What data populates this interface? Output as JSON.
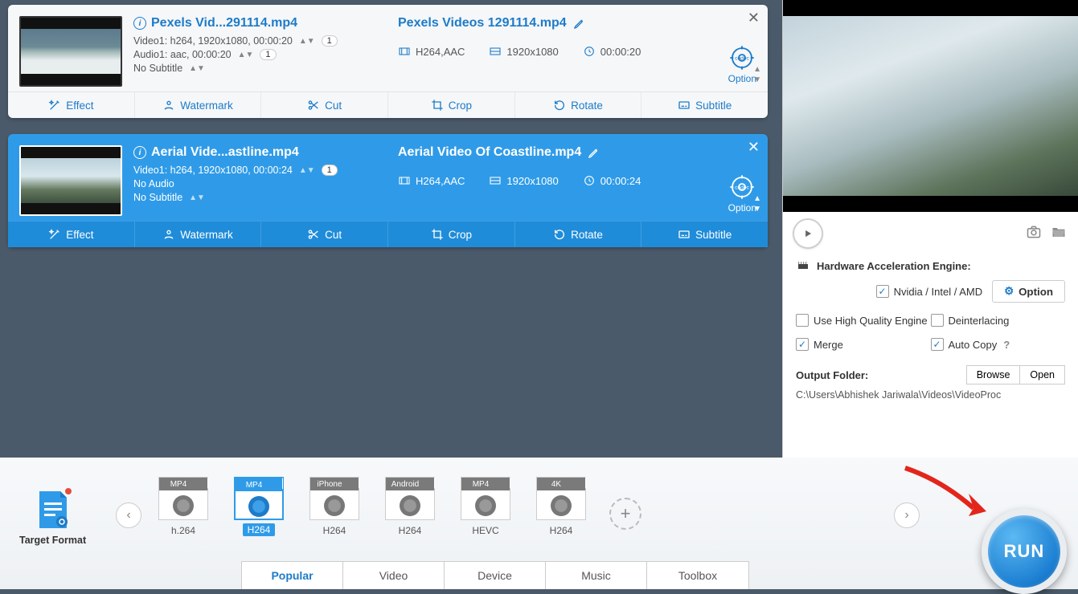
{
  "queue": [
    {
      "title_short": "Pexels Vid...291114.mp4",
      "video_line": "Video1: h264, 1920x1080, 00:00:20",
      "video_count": "1",
      "audio_line": "Audio1: aac, 00:00:20",
      "audio_count": "1",
      "subtitle_line": "No Subtitle",
      "out_title": "Pexels Videos 1291114.mp4",
      "out_codec": "H264,AAC",
      "out_res": "1920x1080",
      "out_dur": "00:00:20",
      "option_label": "Option",
      "selected": false
    },
    {
      "title_short": "Aerial Vide...astline.mp4",
      "video_line": "Video1: h264, 1920x1080, 00:00:24",
      "video_count": "1",
      "audio_line": "No Audio",
      "audio_count": "",
      "subtitle_line": "No Subtitle",
      "out_title": "Aerial Video Of Coastline.mp4",
      "out_codec": "H264,AAC",
      "out_res": "1920x1080",
      "out_dur": "00:00:24",
      "option_label": "Option",
      "selected": true
    }
  ],
  "tools": {
    "effect": "Effect",
    "watermark": "Watermark",
    "cut": "Cut",
    "crop": "Crop",
    "rotate": "Rotate",
    "subtitle": "Subtitle"
  },
  "sidebar": {
    "hw_title": "Hardware Acceleration Engine:",
    "nvidia_label": "Nvidia / Intel / AMD",
    "option_btn": "Option",
    "high_quality": "Use High Quality Engine",
    "deinterlace": "Deinterlacing",
    "merge": "Merge",
    "autocopy": "Auto Copy",
    "output_folder_label": "Output Folder:",
    "browse": "Browse",
    "open": "Open",
    "output_path": "C:\\Users\\Abhishek Jariwala\\Videos\\VideoProc",
    "checks": {
      "nvidia": true,
      "high_quality": false,
      "deinterlace": false,
      "merge": true,
      "autocopy": true
    }
  },
  "target_format_label": "Target Format",
  "formats": [
    {
      "tag": "MP4",
      "cap": "h.264",
      "active": false
    },
    {
      "tag": "MP4",
      "cap": "H264",
      "active": true
    },
    {
      "tag": "iPhone",
      "cap": "H264",
      "active": false
    },
    {
      "tag": "Android",
      "cap": "H264",
      "active": false
    },
    {
      "tag": "MP4",
      "cap": "HEVC",
      "active": false
    },
    {
      "tag": "4K",
      "cap": "H264",
      "active": false
    }
  ],
  "tabs": {
    "popular": "Popular",
    "video": "Video",
    "device": "Device",
    "music": "Music",
    "toolbox": "Toolbox",
    "active": "popular"
  },
  "run_label": "RUN"
}
